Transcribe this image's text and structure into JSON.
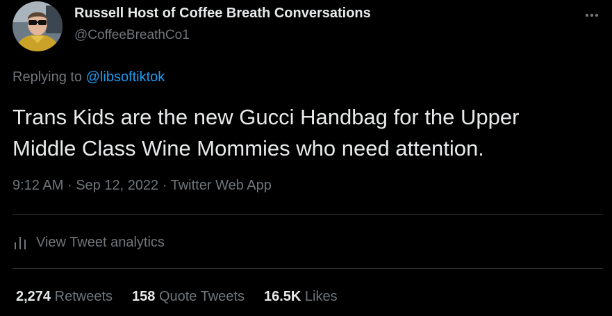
{
  "author": {
    "display_name": "Russell Host of Coffee Breath Conversations",
    "handle": "@CoffeeBreathCo1"
  },
  "reply": {
    "prefix": "Replying to ",
    "mention": "@libsoftiktok"
  },
  "tweet": {
    "line1": "Trans Kids are the new Gucci Handbag for the Upper",
    "line2": "Middle Class Wine Mommies who need attention."
  },
  "meta": {
    "time": "9:12 AM",
    "date": "Sep 12, 2022",
    "source": "Twitter Web App",
    "separator": "·"
  },
  "analytics": {
    "label": "View Tweet analytics"
  },
  "stats": {
    "retweets_count": "2,274",
    "retweets_label": "Retweets",
    "quotes_count": "158",
    "quotes_label": "Quote Tweets",
    "likes_count": "16.5K",
    "likes_label": "Likes"
  },
  "icons": {
    "more": "more-horizontal-icon",
    "analytics": "bar-chart-icon"
  },
  "colors": {
    "background": "#000000",
    "primary_text": "#e7e9ea",
    "secondary_text": "#71767b",
    "link": "#1d9bf0",
    "divider": "#2f3336"
  }
}
